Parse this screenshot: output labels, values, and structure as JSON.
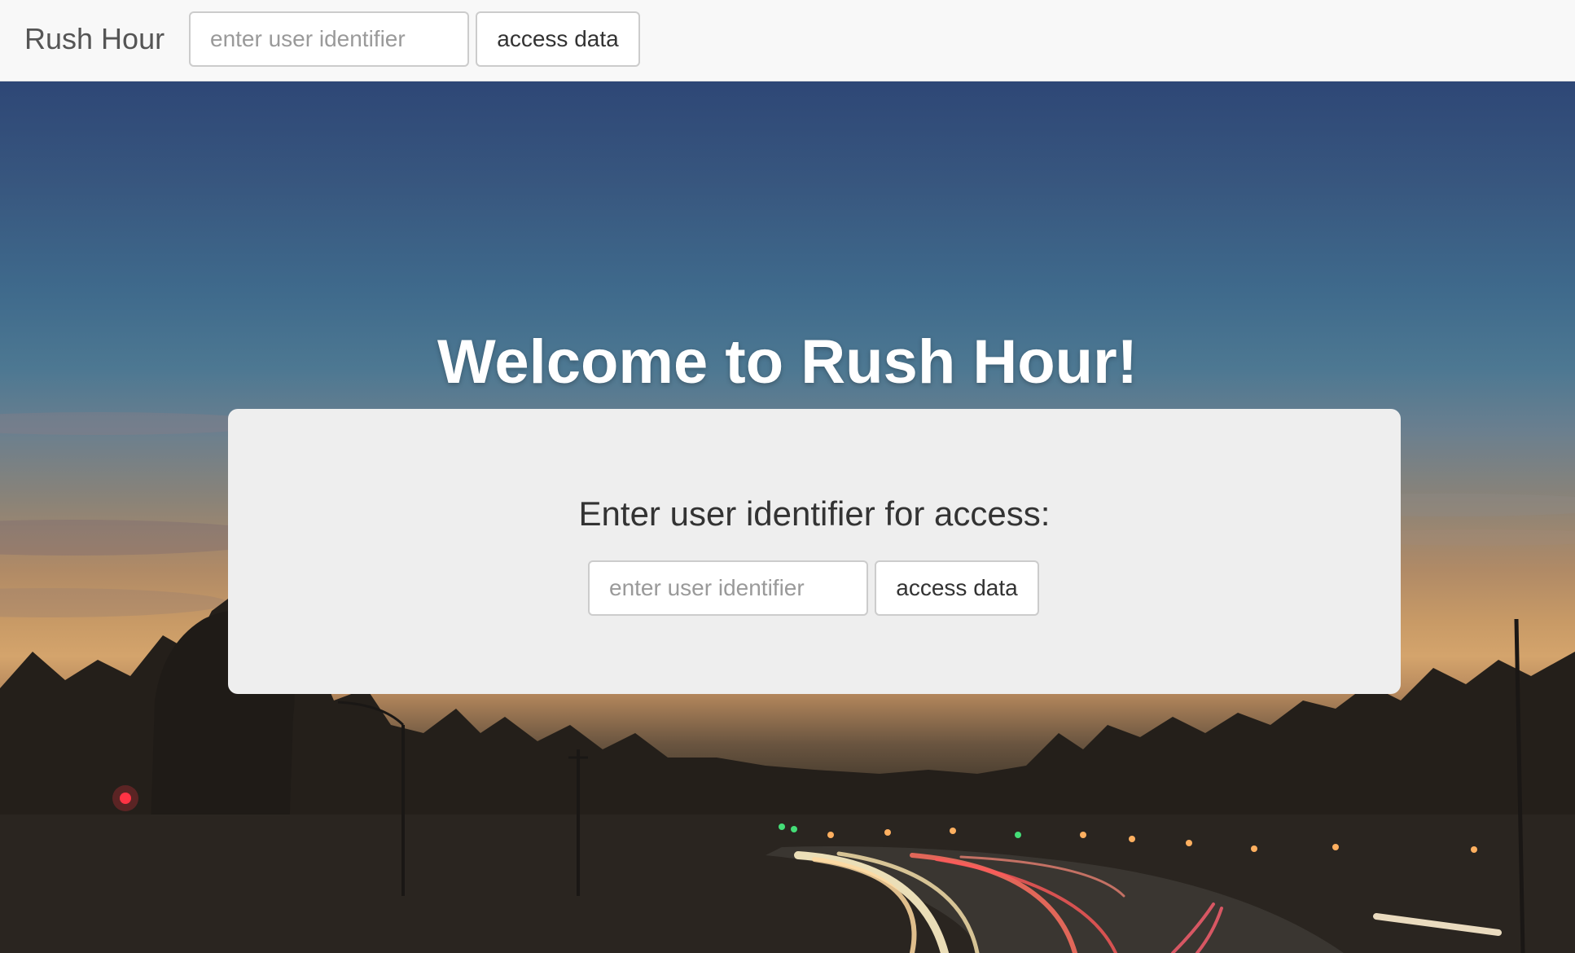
{
  "navbar": {
    "brand": "Rush Hour",
    "input_placeholder": "enter user identifier",
    "button_label": "access data"
  },
  "hero": {
    "heading": "Welcome to Rush Hour!",
    "panel": {
      "prompt": "Enter user identifier for access:",
      "input_placeholder": "enter user identifier",
      "button_label": "access data"
    }
  },
  "colors": {
    "navbar_bg": "#f8f8f8",
    "panel_bg": "#eeeeee",
    "heading_text": "#ffffff",
    "sky_top": "#2e4776",
    "horizon": "#d4a46c"
  }
}
